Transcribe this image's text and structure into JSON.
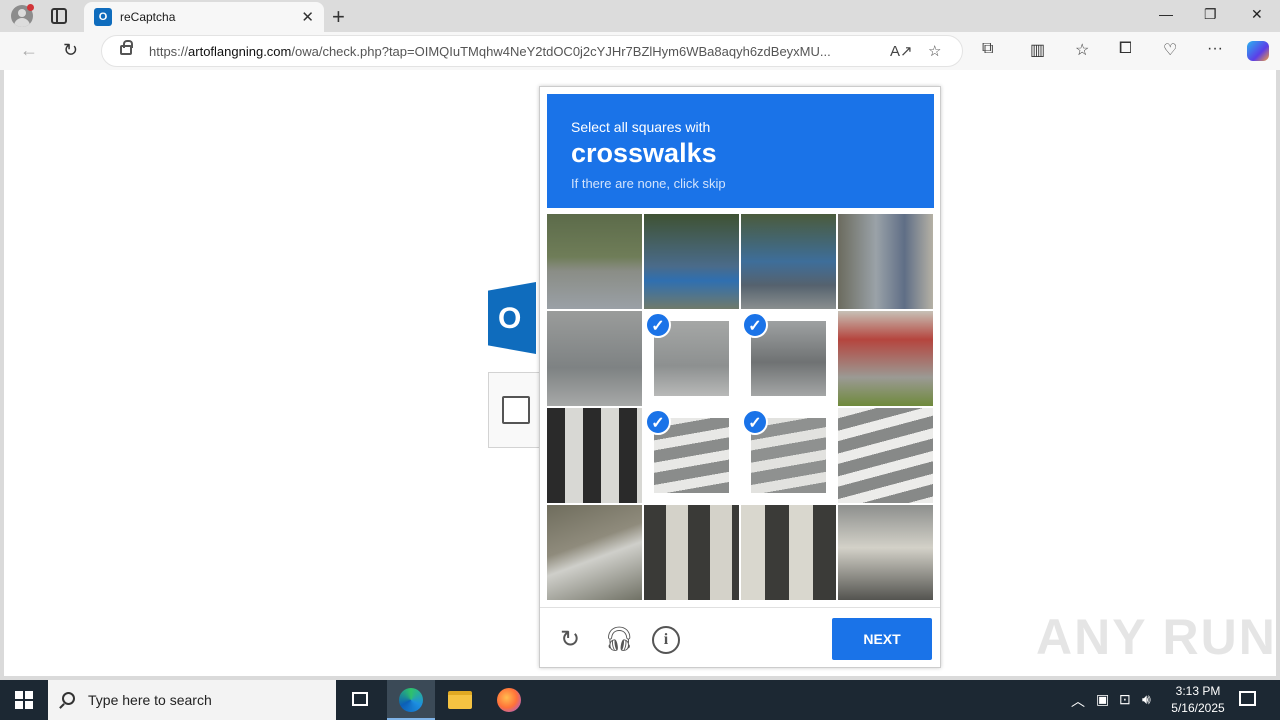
{
  "browser": {
    "tab_title": "reCaptcha",
    "tab_favicon": "O",
    "url_scheme": "https://",
    "url_domain": "artoflangning.com",
    "url_path": "/owa/check.php?tap=OIMQIuTMqhw4NeY2tdOC0j2cYJHr7BZlHym6WBa8aqyh6zdBeyxMU..."
  },
  "captcha": {
    "instruction": "Select all squares with",
    "target": "crosswalks",
    "hint": "If there are none, click skip",
    "next_label": "NEXT",
    "selected_tiles": [
      5,
      6,
      9,
      10
    ]
  },
  "background_logo_letter": "O",
  "watermark": "ANY RUN",
  "taskbar": {
    "search_placeholder": "Type here to search",
    "time": "3:13 PM",
    "date": "5/16/2025"
  }
}
